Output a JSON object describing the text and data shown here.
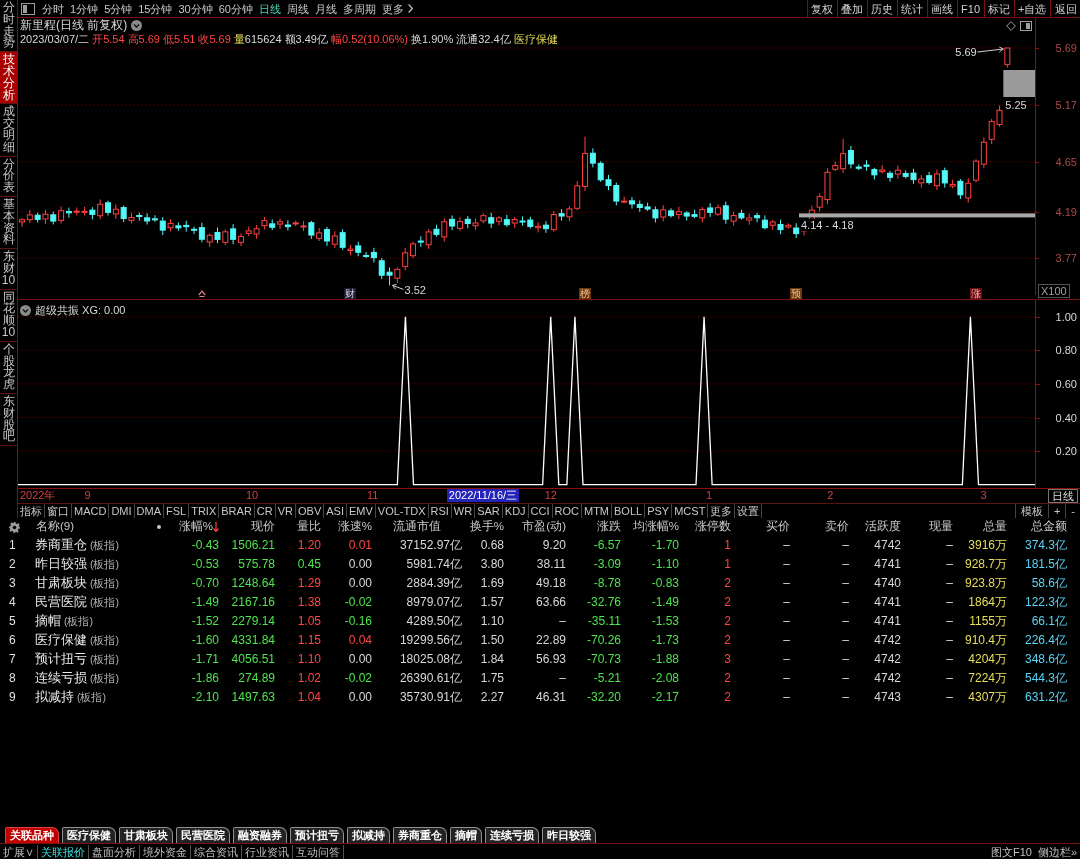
{
  "side_tabs": [
    {
      "label": "分时走势",
      "selected": false
    },
    {
      "label": "技术分析",
      "selected": true
    },
    {
      "label": "成交明细",
      "selected": false
    },
    {
      "label": "分价表",
      "selected": false
    },
    {
      "label": "基本资料",
      "selected": false
    },
    {
      "label": "东财10",
      "selected": false
    },
    {
      "label": "同花顺10",
      "selected": false
    },
    {
      "label": "个股龙虎",
      "selected": false
    },
    {
      "label": "东财股吧",
      "selected": false
    }
  ],
  "period_tabs": [
    {
      "label": "分时",
      "kind": "period",
      "selected": false
    },
    {
      "label": "1分钟",
      "kind": "period",
      "selected": false
    },
    {
      "label": "5分钟",
      "kind": "period",
      "selected": false
    },
    {
      "label": "15分钟",
      "kind": "period",
      "selected": false
    },
    {
      "label": "30分钟",
      "kind": "period",
      "selected": false
    },
    {
      "label": "60分钟",
      "kind": "period",
      "selected": false
    },
    {
      "label": "日线",
      "kind": "period",
      "selected": true
    },
    {
      "label": "周线",
      "kind": "period",
      "selected": false
    },
    {
      "label": "月线",
      "kind": "period",
      "selected": false
    },
    {
      "label": "多周期",
      "kind": "period",
      "selected": false
    },
    {
      "label": "更多",
      "kind": "menu",
      "selected": false
    }
  ],
  "toolbar": [
    "复权",
    "叠加",
    "历史",
    "统计",
    "画线",
    "F10",
    "标记",
    "+自选",
    "返回"
  ],
  "main_chart": {
    "title": "新里程(日线 前复权)",
    "date": "2023/03/07/二",
    "quote": [
      {
        "label": "开",
        "value": "5.54",
        "kind": "up"
      },
      {
        "label": "高",
        "value": "5.69",
        "kind": "up"
      },
      {
        "label": "低",
        "value": "5.51",
        "kind": "up"
      },
      {
        "label": "收",
        "value": "5.69",
        "kind": "up"
      },
      {
        "label": "量",
        "value": "615624",
        "kind": "volume"
      },
      {
        "label": "额",
        "value": "3.49亿",
        "kind": "plain"
      },
      {
        "label": "幅",
        "value": "0.52(10.06%)",
        "kind": "up"
      },
      {
        "label": "换",
        "value": "1.90%",
        "kind": "plain"
      },
      {
        "label": "流通",
        "value": "32.4亿",
        "kind": "plain"
      }
    ],
    "sector": "医疗保健",
    "price_axis": [
      "5.69",
      "5.17",
      "4.65",
      "4.19",
      "3.77"
    ],
    "high_label": "5.69",
    "box_label": "5.25",
    "range_label": "4.14 - 4.18",
    "low_label": "3.52",
    "event_marks": [
      {
        "label": "财",
        "kind": "plain"
      },
      {
        "label": "榜",
        "kind": "warn"
      },
      {
        "label": "预",
        "kind": "warn"
      },
      {
        "label": "涨",
        "kind": "up"
      }
    ],
    "scale": "X100"
  },
  "indicator": {
    "title": "超级共振 XG: 0.00",
    "cursor_date": "2022/11/16/三",
    "period": "日线",
    "x_axis": [
      "2022年",
      "9",
      "10",
      "11",
      "12",
      "1",
      "2",
      "3"
    ],
    "chart_data": {
      "type": "line",
      "grid": true,
      "ylim": [
        -0.02,
        1.1
      ],
      "yticks": [
        {
          "value": 0.2,
          "label": "0.20"
        },
        {
          "value": 0.4,
          "label": "0.40"
        },
        {
          "value": 0.6,
          "label": "0.60"
        },
        {
          "value": 0.8,
          "label": "0.80"
        },
        {
          "value": 1.0,
          "label": "1.00"
        }
      ],
      "values": [
        0,
        0,
        0,
        0,
        0,
        0,
        0,
        0,
        0,
        0,
        0,
        0,
        0,
        0,
        0,
        0,
        0,
        0,
        0,
        0,
        0,
        0,
        0,
        0,
        0,
        0,
        0,
        0,
        0,
        0,
        0,
        0,
        0,
        0,
        0,
        0,
        0,
        0,
        0,
        0,
        0,
        0,
        0,
        0,
        0,
        0,
        0,
        0,
        1,
        0,
        0,
        0,
        0,
        0,
        0,
        0,
        0,
        0,
        0,
        0,
        0,
        0,
        0,
        0,
        0,
        0,
        1,
        0,
        0,
        1,
        0,
        0,
        0,
        0,
        0,
        0,
        0,
        0,
        0,
        0,
        0,
        0,
        0,
        0,
        0,
        1,
        0,
        0,
        0,
        0,
        0,
        0,
        0,
        0,
        0,
        0,
        0,
        0,
        0,
        0,
        0,
        0,
        0,
        0,
        0,
        0,
        0,
        0,
        0,
        0,
        0,
        0,
        0,
        0,
        0,
        0,
        0,
        0,
        1,
        0,
        0,
        0,
        0,
        0,
        0,
        0,
        0
      ]
    }
  },
  "indicator_tabs": [
    "指标",
    "窗口",
    "MACD",
    "DMI",
    "DMA",
    "FSL",
    "TRIX",
    "BRAR",
    "CR",
    "VR",
    "OBV",
    "ASI",
    "EMV",
    "VOL-TDX",
    "RSI",
    "WR",
    "SAR",
    "KDJ",
    "CCI",
    "ROC",
    "MTM",
    "BOLL",
    "PSY",
    "MCST",
    "更多",
    "设置"
  ],
  "template_controls": [
    "模板",
    "+",
    "-"
  ],
  "table": {
    "columns": [
      "名称(9)",
      "涨幅%",
      "现价",
      "量比",
      "涨速%",
      "流通市值",
      "换手%",
      "市盈(动)",
      "涨跌",
      "均涨幅%",
      "涨停数",
      "买价",
      "卖价",
      "活跃度",
      "现量",
      "总量",
      "总金额"
    ],
    "rows": [
      {
        "index": "1",
        "cells": [
          {
            "text": "券商重仓",
            "tag": "(板指)"
          },
          {
            "text": "-0.43",
            "color": "#4ee44e"
          },
          {
            "text": "1506.21",
            "color": "#4ee44e"
          },
          {
            "text": "1.20",
            "color": "#ff4545"
          },
          {
            "text": "0.01",
            "color": "#ff4545"
          },
          {
            "text": "37152.97亿",
            "color": "#d8d8d8"
          },
          {
            "text": "0.68",
            "color": "#d8d8d8"
          },
          {
            "text": "9.20",
            "color": "#d8d8d8"
          },
          {
            "text": "-6.57",
            "color": "#4ee44e"
          },
          {
            "text": "-1.70",
            "color": "#4ee44e"
          },
          {
            "text": "1",
            "color": "#ff4545"
          },
          {
            "text": "–"
          },
          {
            "text": "–"
          },
          {
            "text": "4742",
            "color": "#d8d8d8"
          },
          {
            "text": "–"
          },
          {
            "text": "3916万",
            "color": "#e8df5a"
          },
          {
            "text": "374.3亿",
            "color": "#5ad5f5"
          }
        ]
      },
      {
        "index": "2",
        "cells": [
          {
            "text": "昨日较强",
            "tag": "(板指)"
          },
          {
            "text": "-0.53",
            "color": "#4ee44e"
          },
          {
            "text": "575.78",
            "color": "#4ee44e"
          },
          {
            "text": "0.45",
            "color": "#4ee44e"
          },
          {
            "text": "0.00",
            "color": "#d8d8d8"
          },
          {
            "text": "5981.74亿",
            "color": "#d8d8d8"
          },
          {
            "text": "3.80",
            "color": "#d8d8d8"
          },
          {
            "text": "38.11",
            "color": "#d8d8d8"
          },
          {
            "text": "-3.09",
            "color": "#4ee44e"
          },
          {
            "text": "-1.10",
            "color": "#4ee44e"
          },
          {
            "text": "1",
            "color": "#ff4545"
          },
          {
            "text": "–"
          },
          {
            "text": "–"
          },
          {
            "text": "4741",
            "color": "#d8d8d8"
          },
          {
            "text": "–"
          },
          {
            "text": "928.7万",
            "color": "#e8df5a"
          },
          {
            "text": "181.5亿",
            "color": "#5ad5f5"
          }
        ]
      },
      {
        "index": "3",
        "cells": [
          {
            "text": "甘肃板块",
            "tag": "(板指)"
          },
          {
            "text": "-0.70",
            "color": "#4ee44e"
          },
          {
            "text": "1248.64",
            "color": "#4ee44e"
          },
          {
            "text": "1.29",
            "color": "#ff4545"
          },
          {
            "text": "0.00",
            "color": "#d8d8d8"
          },
          {
            "text": "2884.39亿",
            "color": "#d8d8d8"
          },
          {
            "text": "1.69",
            "color": "#d8d8d8"
          },
          {
            "text": "49.18",
            "color": "#d8d8d8"
          },
          {
            "text": "-8.78",
            "color": "#4ee44e"
          },
          {
            "text": "-0.83",
            "color": "#4ee44e"
          },
          {
            "text": "2",
            "color": "#ff4545"
          },
          {
            "text": "–"
          },
          {
            "text": "–"
          },
          {
            "text": "4740",
            "color": "#d8d8d8"
          },
          {
            "text": "–"
          },
          {
            "text": "923.8万",
            "color": "#e8df5a"
          },
          {
            "text": "58.6亿",
            "color": "#5ad5f5"
          }
        ]
      },
      {
        "index": "4",
        "cells": [
          {
            "text": "民营医院",
            "tag": "(板指)"
          },
          {
            "text": "-1.49",
            "color": "#4ee44e"
          },
          {
            "text": "2167.16",
            "color": "#4ee44e"
          },
          {
            "text": "1.38",
            "color": "#ff4545"
          },
          {
            "text": "-0.02",
            "color": "#4ee44e"
          },
          {
            "text": "8979.07亿",
            "color": "#d8d8d8"
          },
          {
            "text": "1.57",
            "color": "#d8d8d8"
          },
          {
            "text": "63.66",
            "color": "#d8d8d8"
          },
          {
            "text": "-32.76",
            "color": "#4ee44e"
          },
          {
            "text": "-1.49",
            "color": "#4ee44e"
          },
          {
            "text": "2",
            "color": "#ff4545"
          },
          {
            "text": "–"
          },
          {
            "text": "–"
          },
          {
            "text": "4741",
            "color": "#d8d8d8"
          },
          {
            "text": "–"
          },
          {
            "text": "1864万",
            "color": "#e8df5a"
          },
          {
            "text": "122.3亿",
            "color": "#5ad5f5"
          }
        ]
      },
      {
        "index": "5",
        "cells": [
          {
            "text": "摘帽",
            "tag": "(板指)"
          },
          {
            "text": "-1.52",
            "color": "#4ee44e"
          },
          {
            "text": "2279.14",
            "color": "#4ee44e"
          },
          {
            "text": "1.05",
            "color": "#ff4545"
          },
          {
            "text": "-0.16",
            "color": "#4ee44e"
          },
          {
            "text": "4289.50亿",
            "color": "#d8d8d8"
          },
          {
            "text": "1.10",
            "color": "#d8d8d8"
          },
          {
            "text": "–"
          },
          {
            "text": "-35.11",
            "color": "#4ee44e"
          },
          {
            "text": "-1.53",
            "color": "#4ee44e"
          },
          {
            "text": "2",
            "color": "#ff4545"
          },
          {
            "text": "–"
          },
          {
            "text": "–"
          },
          {
            "text": "4741",
            "color": "#d8d8d8"
          },
          {
            "text": "–"
          },
          {
            "text": "1155万",
            "color": "#e8df5a"
          },
          {
            "text": "66.1亿",
            "color": "#5ad5f5"
          }
        ]
      },
      {
        "index": "6",
        "cells": [
          {
            "text": "医疗保健",
            "tag": "(板指)"
          },
          {
            "text": "-1.60",
            "color": "#4ee44e"
          },
          {
            "text": "4331.84",
            "color": "#4ee44e"
          },
          {
            "text": "1.15",
            "color": "#ff4545"
          },
          {
            "text": "0.04",
            "color": "#ff4545"
          },
          {
            "text": "19299.56亿",
            "color": "#d8d8d8"
          },
          {
            "text": "1.50",
            "color": "#d8d8d8"
          },
          {
            "text": "22.89",
            "color": "#d8d8d8"
          },
          {
            "text": "-70.26",
            "color": "#4ee44e"
          },
          {
            "text": "-1.73",
            "color": "#4ee44e"
          },
          {
            "text": "2",
            "color": "#ff4545"
          },
          {
            "text": "–"
          },
          {
            "text": "–"
          },
          {
            "text": "4742",
            "color": "#d8d8d8"
          },
          {
            "text": "–"
          },
          {
            "text": "910.4万",
            "color": "#e8df5a"
          },
          {
            "text": "226.4亿",
            "color": "#5ad5f5"
          }
        ]
      },
      {
        "index": "7",
        "cells": [
          {
            "text": "预计扭亏",
            "tag": "(板指)"
          },
          {
            "text": "-1.71",
            "color": "#4ee44e"
          },
          {
            "text": "4056.51",
            "color": "#4ee44e"
          },
          {
            "text": "1.10",
            "color": "#ff4545"
          },
          {
            "text": "0.00",
            "color": "#d8d8d8"
          },
          {
            "text": "18025.08亿",
            "color": "#d8d8d8"
          },
          {
            "text": "1.84",
            "color": "#d8d8d8"
          },
          {
            "text": "56.93",
            "color": "#d8d8d8"
          },
          {
            "text": "-70.73",
            "color": "#4ee44e"
          },
          {
            "text": "-1.88",
            "color": "#4ee44e"
          },
          {
            "text": "3",
            "color": "#ff4545"
          },
          {
            "text": "–"
          },
          {
            "text": "–"
          },
          {
            "text": "4742",
            "color": "#d8d8d8"
          },
          {
            "text": "–"
          },
          {
            "text": "4204万",
            "color": "#e8df5a"
          },
          {
            "text": "348.6亿",
            "color": "#5ad5f5"
          }
        ]
      },
      {
        "index": "8",
        "cells": [
          {
            "text": "连续亏损",
            "tag": "(板指)"
          },
          {
            "text": "-1.86",
            "color": "#4ee44e"
          },
          {
            "text": "274.89",
            "color": "#4ee44e"
          },
          {
            "text": "1.02",
            "color": "#ff4545"
          },
          {
            "text": "-0.02",
            "color": "#4ee44e"
          },
          {
            "text": "26390.61亿",
            "color": "#d8d8d8"
          },
          {
            "text": "1.75",
            "color": "#d8d8d8"
          },
          {
            "text": "–"
          },
          {
            "text": "-5.21",
            "color": "#4ee44e"
          },
          {
            "text": "-2.08",
            "color": "#4ee44e"
          },
          {
            "text": "2",
            "color": "#ff4545"
          },
          {
            "text": "–"
          },
          {
            "text": "–"
          },
          {
            "text": "4742",
            "color": "#d8d8d8"
          },
          {
            "text": "–"
          },
          {
            "text": "7224万",
            "color": "#e8df5a"
          },
          {
            "text": "544.3亿",
            "color": "#5ad5f5"
          }
        ]
      },
      {
        "index": "9",
        "cells": [
          {
            "text": "拟减持",
            "tag": "(板指)"
          },
          {
            "text": "-2.10",
            "color": "#4ee44e"
          },
          {
            "text": "1497.63",
            "color": "#4ee44e"
          },
          {
            "text": "1.04",
            "color": "#ff4545"
          },
          {
            "text": "0.00",
            "color": "#d8d8d8"
          },
          {
            "text": "35730.91亿",
            "color": "#d8d8d8"
          },
          {
            "text": "2.27",
            "color": "#d8d8d8"
          },
          {
            "text": "46.31",
            "color": "#d8d8d8"
          },
          {
            "text": "-32.20",
            "color": "#4ee44e"
          },
          {
            "text": "-2.17",
            "color": "#4ee44e"
          },
          {
            "text": "2",
            "color": "#ff4545"
          },
          {
            "text": "–"
          },
          {
            "text": "–"
          },
          {
            "text": "4743",
            "color": "#d8d8d8"
          },
          {
            "text": "–"
          },
          {
            "text": "4307万",
            "color": "#e8df5a"
          },
          {
            "text": "631.2亿",
            "color": "#5ad5f5"
          }
        ]
      }
    ]
  },
  "bottom_tabs": [
    {
      "label": "关联品种",
      "selected": true
    },
    {
      "label": "医疗保健",
      "selected": false
    },
    {
      "label": "甘肃板块",
      "selected": false
    },
    {
      "label": "民营医院",
      "selected": false
    },
    {
      "label": "融资融券",
      "selected": false
    },
    {
      "label": "预计扭亏",
      "selected": false
    },
    {
      "label": "拟减持",
      "selected": false
    },
    {
      "label": "券商重仓",
      "selected": false
    },
    {
      "label": "摘帽",
      "selected": false
    },
    {
      "label": "连续亏损",
      "selected": false
    },
    {
      "label": "昨日较强",
      "selected": false
    }
  ],
  "status_bar": {
    "items": [
      {
        "label": "扩展∨",
        "selected": false
      },
      {
        "label": "关联报价",
        "selected": true
      },
      {
        "label": "盘面分析",
        "selected": false
      },
      {
        "label": "境外资金",
        "selected": false
      },
      {
        "label": "综合资讯",
        "selected": false
      },
      {
        "label": "行业资讯",
        "selected": false
      },
      {
        "label": "互动问答",
        "selected": false
      }
    ],
    "right": [
      "图文F10",
      "侧边栏»"
    ]
  }
}
